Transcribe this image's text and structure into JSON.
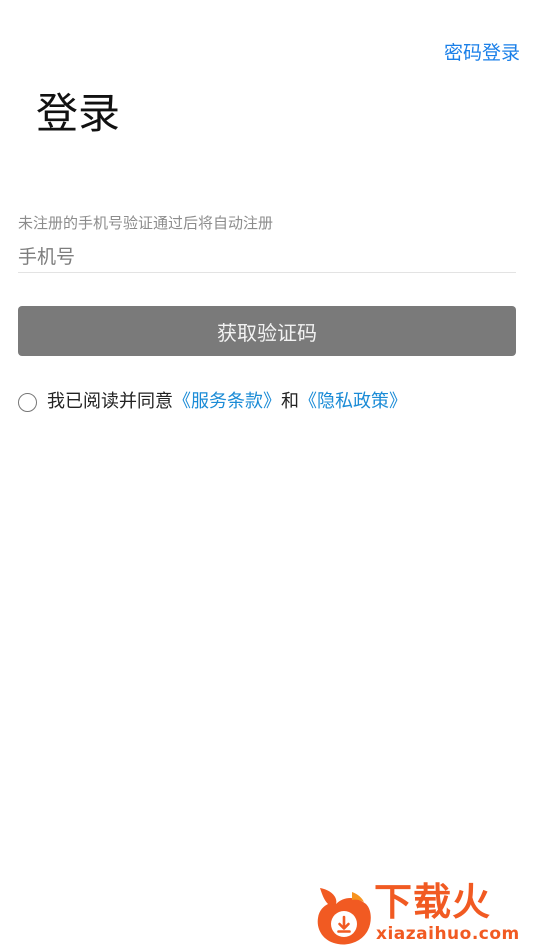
{
  "header": {
    "password_login_label": "密码登录"
  },
  "page": {
    "title": "登录"
  },
  "form": {
    "hint": "未注册的手机号验证通过后将自动注册",
    "phone_placeholder": "手机号",
    "phone_value": "",
    "get_code_label": "获取验证码"
  },
  "agreement": {
    "prefix": "我已阅读并同意",
    "terms_link": "《服务条款》",
    "and": "和",
    "privacy_link": "《隐私政策》",
    "checked": false
  },
  "watermark": {
    "title": "下载火",
    "domain": "xiazaihuo.com",
    "icon": "flame-download-icon"
  },
  "colors": {
    "accent_link": "#1a7fe8",
    "agreement_link": "#1a8bd6",
    "button_bg": "#7a7a7a",
    "watermark": "#f15a22"
  }
}
